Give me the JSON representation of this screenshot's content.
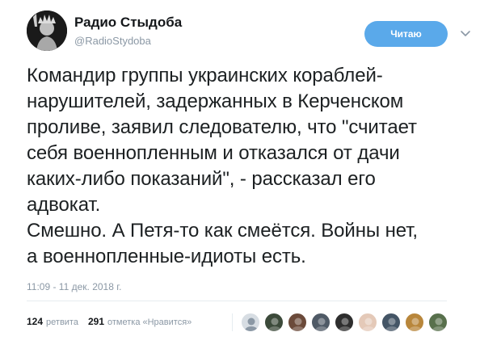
{
  "author": {
    "name": "Радио Стыдоба",
    "handle": "@RadioStydoba"
  },
  "follow_button": {
    "label": "Читаю"
  },
  "tweet": {
    "text": "Командир группы украинских кораблей-\nнарушителей, задержанных в Керченском\nпроливе, заявил следователю, что \"считает\nсебя военнопленным и отказался от дачи\nкаких-либо показаний\", - рассказал его\nадвокат.\nСмешно. А Петя-то как смеётся. Войны нет,\nа военнопленные-идиоты есть."
  },
  "timestamp": "11:09 - 11 дек. 2018 г.",
  "stats": {
    "retweets_count": "124",
    "retweets_label": "ретвита",
    "likes_count": "291",
    "likes_label": "отметка «Нравится»"
  },
  "likers": [
    {
      "color": "#d7dde3"
    },
    {
      "color": "#3c4a3a"
    },
    {
      "color": "#6b4a3a"
    },
    {
      "color": "#4f5a66"
    },
    {
      "color": "#2e2e2e"
    },
    {
      "color": "#e4c9b8"
    },
    {
      "color": "#445566"
    },
    {
      "color": "#b8863b"
    },
    {
      "color": "#58704c"
    }
  ],
  "colors": {
    "accent": "#5aa9ea",
    "muted": "#8b98a5"
  }
}
